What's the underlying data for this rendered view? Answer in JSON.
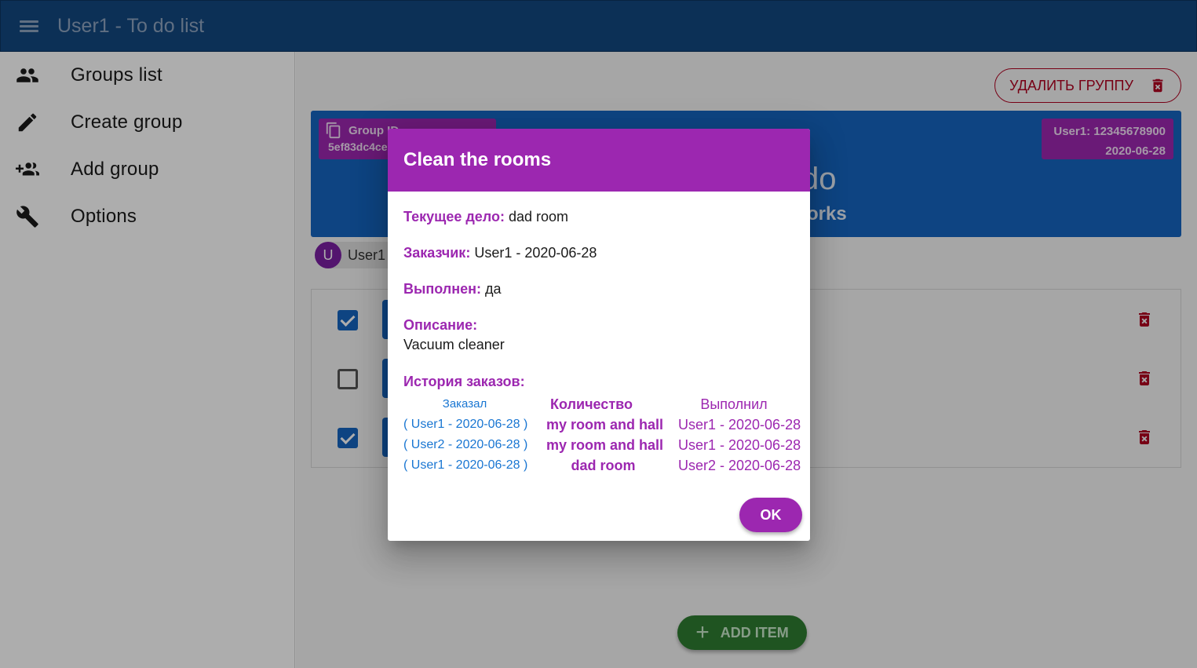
{
  "app": {
    "title": "User1 - To do list"
  },
  "sidebar": {
    "items": [
      {
        "label": "Groups list",
        "icon": "people-icon"
      },
      {
        "label": "Create group",
        "icon": "pencil-icon"
      },
      {
        "label": "Add group",
        "icon": "group-add-icon"
      },
      {
        "label": "Options",
        "icon": "wrench-icon"
      }
    ]
  },
  "main": {
    "delete_group_label": "Удалить группу",
    "group_card": {
      "id_label": "Group ID",
      "id_value": "5ef83dc4ce",
      "owner": "User1: 12345678900",
      "date": "2020-06-28",
      "title_partial": "do",
      "subtitle_partial": "orks"
    },
    "member": {
      "initial": "U",
      "name": "User1"
    },
    "items": [
      {
        "checked": true
      },
      {
        "checked": false
      },
      {
        "checked": true
      }
    ],
    "add_item_label": "Add item"
  },
  "dialog": {
    "title": "Clean the rooms",
    "current_label": "Текущее дело:",
    "current_value": "dad room",
    "customer_label": "Заказчик:",
    "customer_value": "User1 - 2020-06-28",
    "done_label": "Выполнен:",
    "done_value": "да",
    "description_label": "Описание:",
    "description_value": "Vacuum cleaner",
    "history_label": "История заказов:",
    "history": {
      "headers": {
        "ordered": "Заказал",
        "quantity": "Количество",
        "performed": "Выполнил"
      },
      "rows": [
        {
          "ordered": "( User1 - 2020-06-28 )",
          "quantity": "my room and hall",
          "performed": "User1 - 2020-06-28"
        },
        {
          "ordered": "( User2 - 2020-06-28 )",
          "quantity": "my room and hall",
          "performed": "User1 - 2020-06-28"
        },
        {
          "ordered": "( User1 - 2020-06-28 )",
          "quantity": "dad room",
          "performed": "User2 - 2020-06-28"
        }
      ]
    },
    "ok_label": "OK"
  },
  "colors": {
    "appbar": "#13477f",
    "primary_blue": "#1565c0",
    "purple": "#9c27b0",
    "danger": "#b00020",
    "success": "#2e7d32"
  }
}
